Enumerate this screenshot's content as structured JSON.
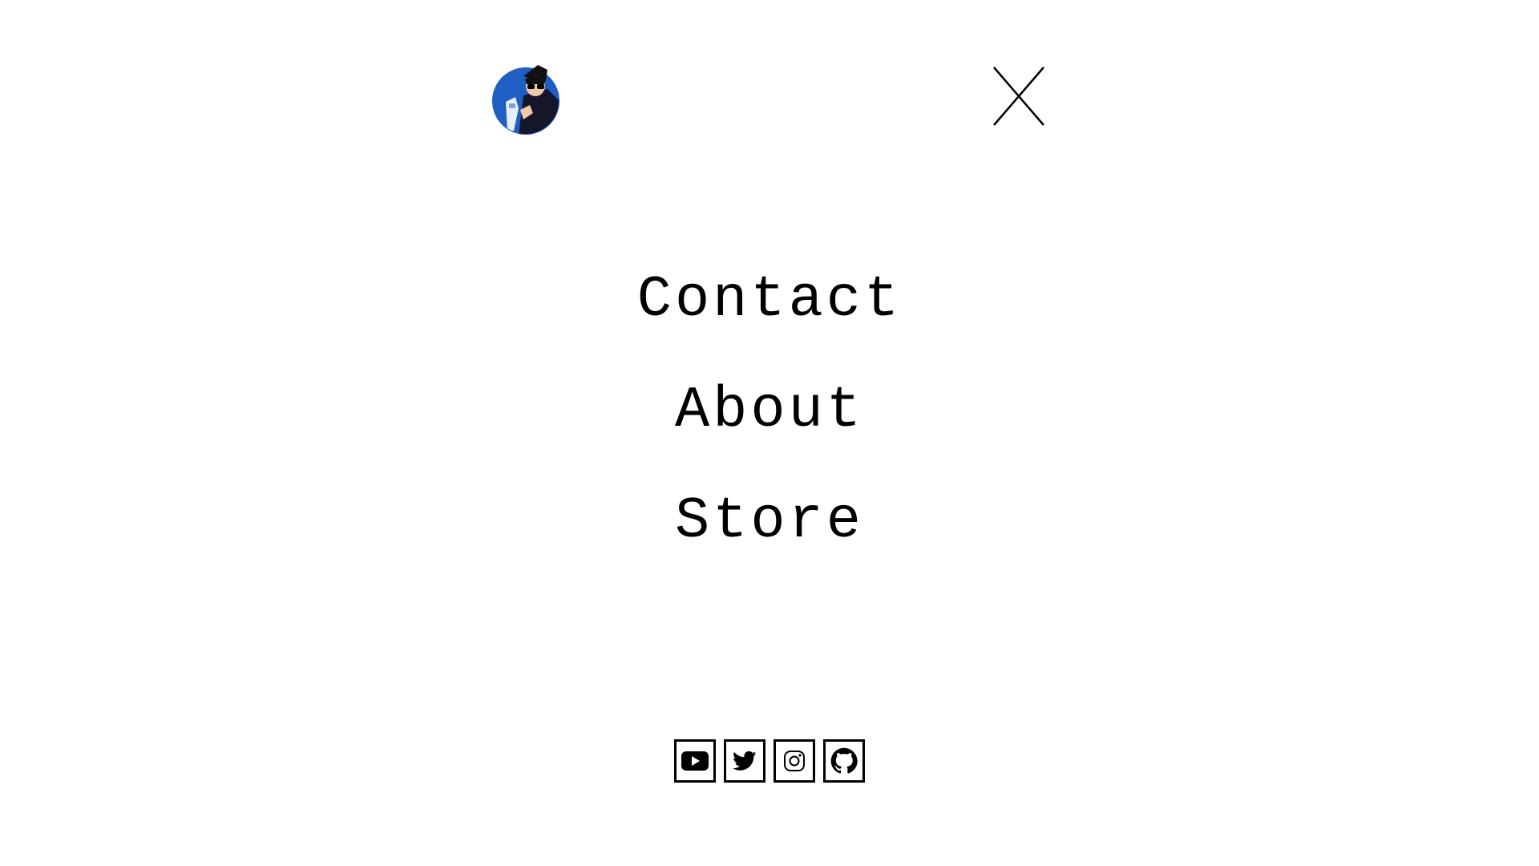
{
  "header": {
    "avatar_icon": "avatar-person-holding-robot-icon",
    "close_icon": "close-x-icon"
  },
  "menu": {
    "items": [
      {
        "label": "Contact"
      },
      {
        "label": "About"
      },
      {
        "label": "Store"
      }
    ]
  },
  "social": {
    "items": [
      {
        "icon": "youtube-icon"
      },
      {
        "icon": "twitter-icon"
      },
      {
        "icon": "instagram-icon"
      },
      {
        "icon": "github-icon"
      }
    ]
  },
  "colors": {
    "background": "#ffffff",
    "text": "#000000",
    "avatar_blue": "#1f5fc4",
    "avatar_dark": "#16162a"
  }
}
